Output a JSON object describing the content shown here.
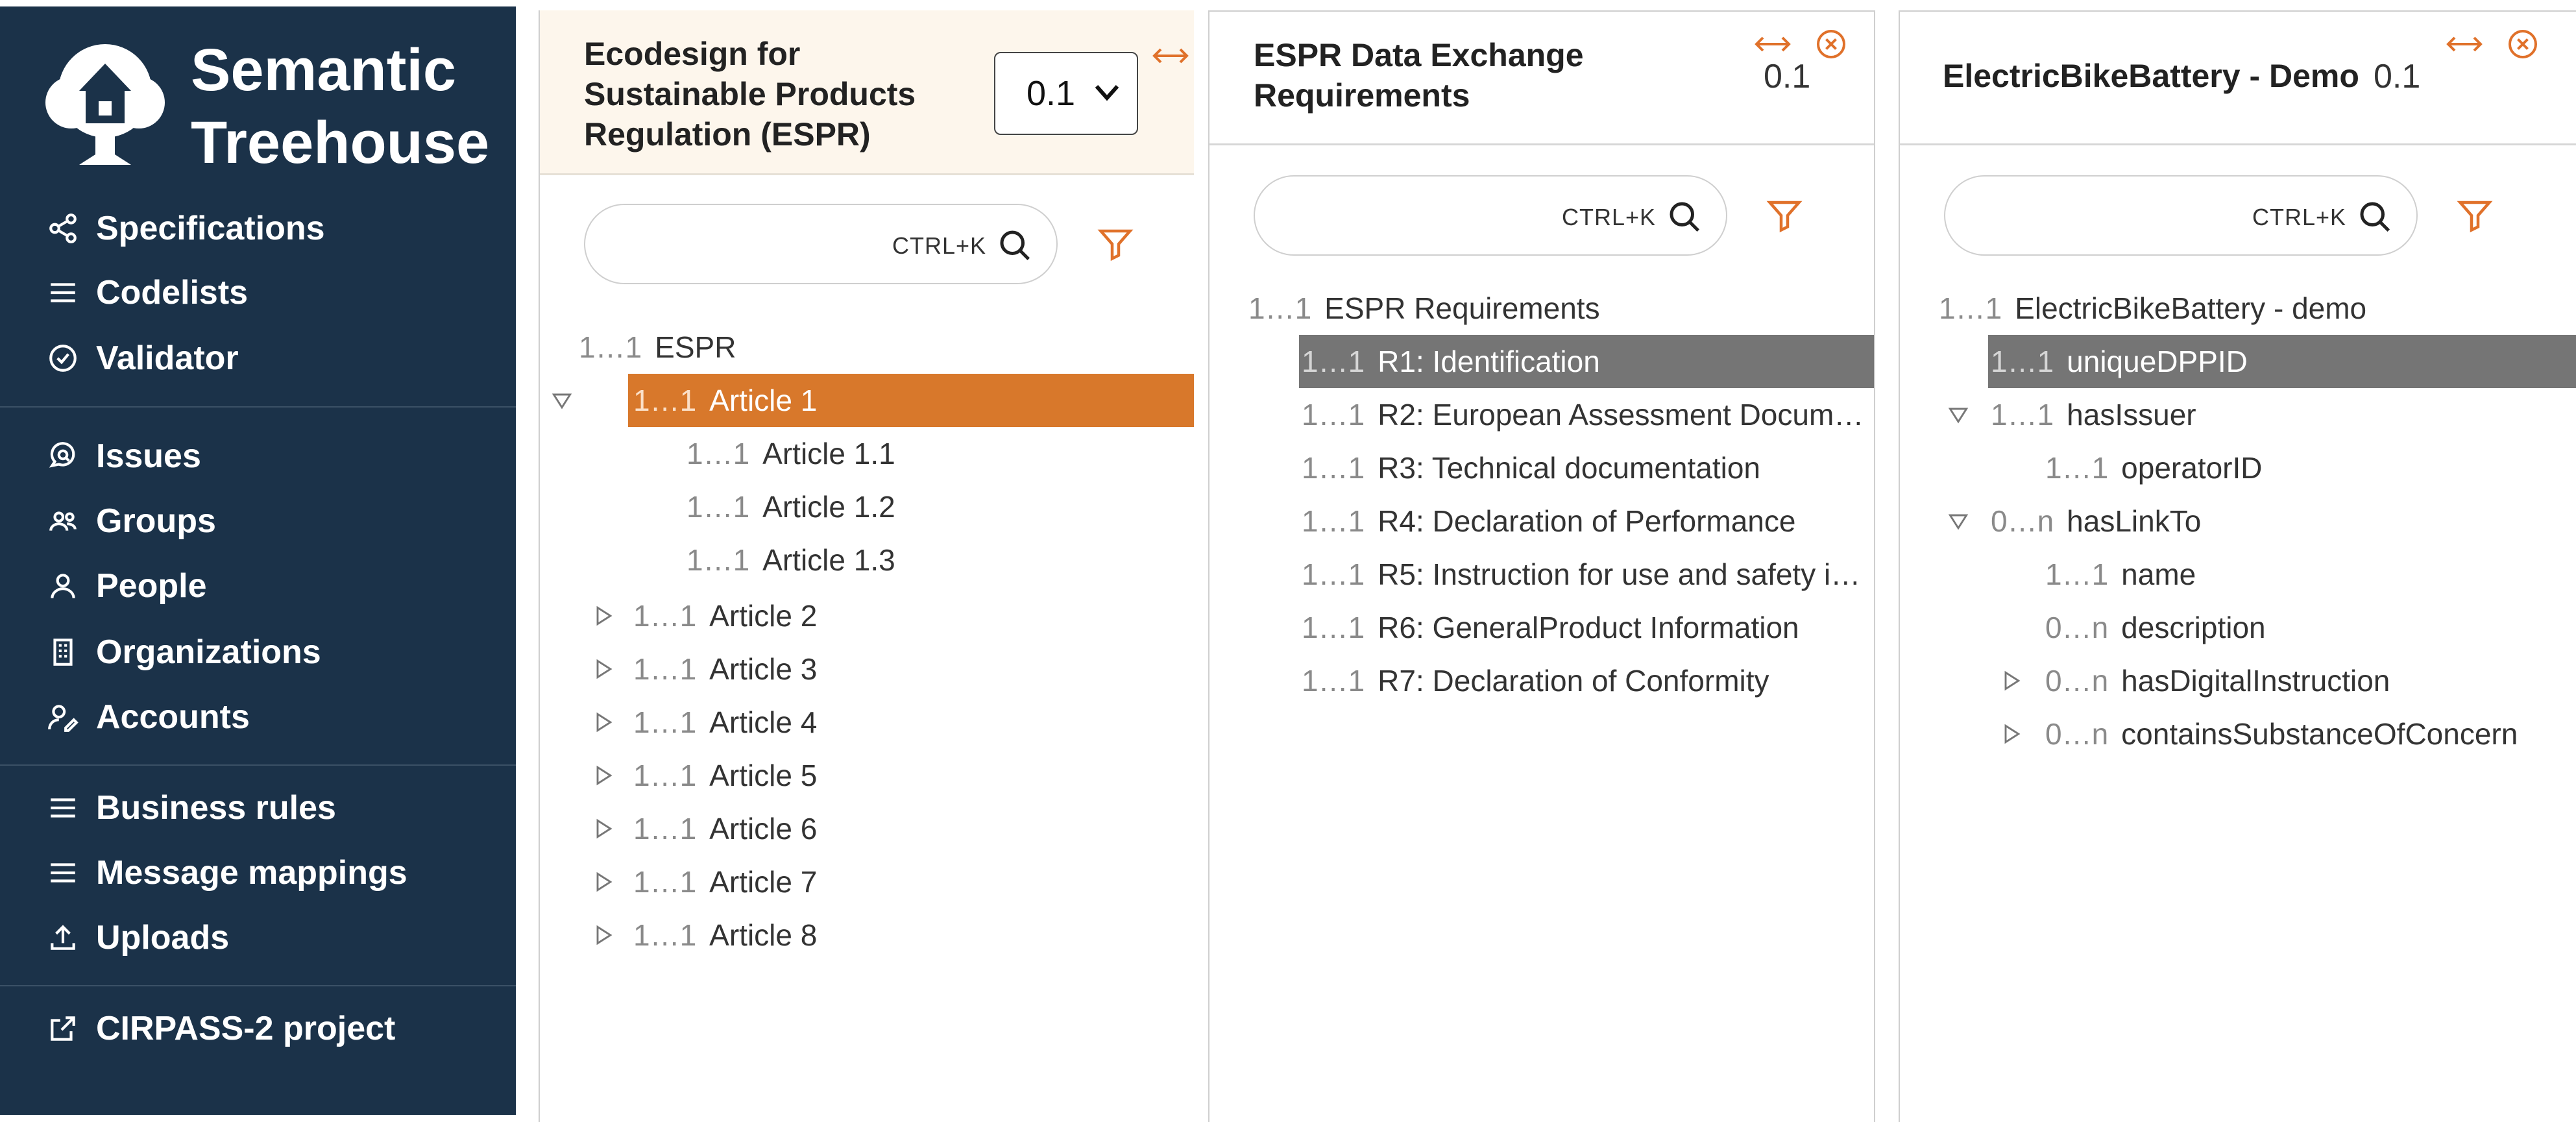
{
  "sidebar": {
    "brand_line1": "Semantic",
    "brand_line2": "Treehouse",
    "items": [
      {
        "label": "Specifications",
        "icon": "share-icon"
      },
      {
        "label": "Codelists",
        "icon": "list-icon"
      },
      {
        "label": "Validator",
        "icon": "check-circle-icon"
      },
      {
        "label": "Issues",
        "icon": "chat-search-icon"
      },
      {
        "label": "Groups",
        "icon": "group-icon"
      },
      {
        "label": "People",
        "icon": "person-icon"
      },
      {
        "label": "Organizations",
        "icon": "building-icon"
      },
      {
        "label": "Accounts",
        "icon": "user-edit-icon"
      },
      {
        "label": "Business rules",
        "icon": "list-icon"
      },
      {
        "label": "Message mappings",
        "icon": "list-icon"
      },
      {
        "label": "Uploads",
        "icon": "upload-icon"
      },
      {
        "label": "CIRPASS-2 project",
        "icon": "external-link-icon"
      }
    ]
  },
  "panel1": {
    "title_line1": "Ecodesign for",
    "title_line2": "Sustainable Products",
    "title_line3": "Regulation (ESPR)",
    "version_select": "0.1",
    "search_shortcut": "CTRL+K",
    "tree": [
      {
        "card": "1…1",
        "label": "ESPR"
      },
      {
        "card": "1…1",
        "label": "Article 1"
      },
      {
        "card": "1…1",
        "label": "Article 1.1"
      },
      {
        "card": "1…1",
        "label": "Article 1.2"
      },
      {
        "card": "1…1",
        "label": "Article 1.3"
      },
      {
        "card": "1…1",
        "label": "Article 2"
      },
      {
        "card": "1…1",
        "label": "Article 3"
      },
      {
        "card": "1…1",
        "label": "Article 4"
      },
      {
        "card": "1…1",
        "label": "Article 5"
      },
      {
        "card": "1…1",
        "label": "Article 6"
      },
      {
        "card": "1…1",
        "label": "Article 7"
      },
      {
        "card": "1…1",
        "label": "Article 8"
      }
    ]
  },
  "panel2": {
    "title_line1": "ESPR Data Exchange",
    "title_line2": "Requirements",
    "version": "0.1",
    "search_shortcut": "CTRL+K",
    "tree": [
      {
        "card": "1…1",
        "label": "ESPR Requirements"
      },
      {
        "card": "1…1",
        "label": "R1: Identification"
      },
      {
        "card": "1…1",
        "label": "R2: European Assessment Docum…"
      },
      {
        "card": "1…1",
        "label": "R3: Technical documentation"
      },
      {
        "card": "1…1",
        "label": "R4: Declaration of Performance"
      },
      {
        "card": "1…1",
        "label": "R5: Instruction for use and safety i…"
      },
      {
        "card": "1…1",
        "label": "R6: GeneralProduct Information"
      },
      {
        "card": "1…1",
        "label": "R7: Declaration of Conformity"
      }
    ]
  },
  "panel3": {
    "title": "ElectricBikeBattery - Demo",
    "version": "0.1",
    "search_shortcut": "CTRL+K",
    "tree": [
      {
        "card": "1…1",
        "label": "ElectricBikeBattery - demo"
      },
      {
        "card": "1…1",
        "label": "uniqueDPPID"
      },
      {
        "card": "1…1",
        "label": "hasIssuer"
      },
      {
        "card": "1…1",
        "label": "operatorID"
      },
      {
        "card": "0…n",
        "label": "hasLinkTo"
      },
      {
        "card": "1…1",
        "label": "name"
      },
      {
        "card": "0…n",
        "label": "description"
      },
      {
        "card": "0…n",
        "label": "hasDigitalInstruction"
      },
      {
        "card": "0…n",
        "label": "containsSubstanceOfConcern"
      }
    ]
  },
  "colors": {
    "sidebar_bg": "#1b3249",
    "accent_orange": "#d8782b",
    "selected_gray": "#757575",
    "close_icon": "#e0712a"
  }
}
